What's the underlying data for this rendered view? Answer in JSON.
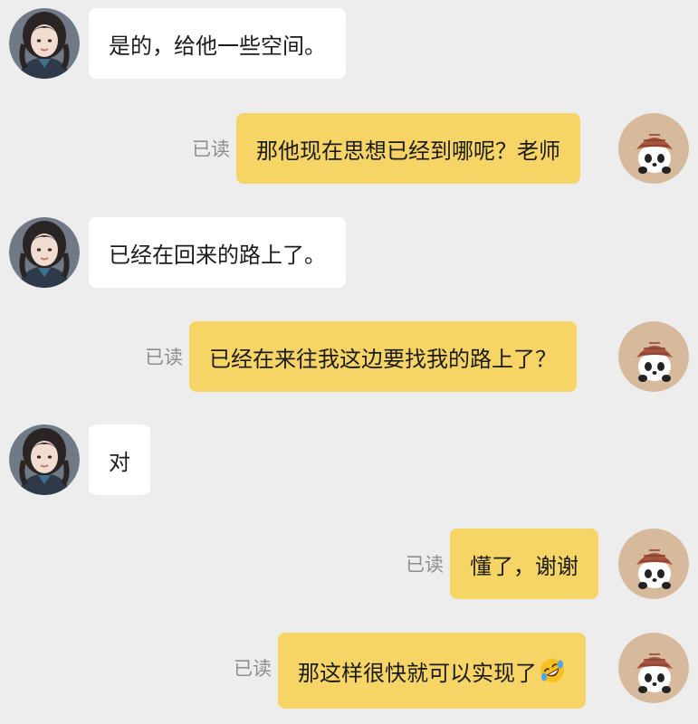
{
  "messages": [
    {
      "side": "in",
      "text": "是的，给他一些空间。"
    },
    {
      "side": "out",
      "text": "那他现在思想已经到哪呢？老师",
      "status": "已读"
    },
    {
      "side": "in",
      "text": "已经在回来的路上了。"
    },
    {
      "side": "out",
      "text": "已经在来往我这边要找我的路上了？",
      "status": "已读"
    },
    {
      "side": "in",
      "text": "对"
    },
    {
      "side": "out",
      "text": "懂了，谢谢",
      "status": "已读"
    },
    {
      "side": "out",
      "text": "那这样很快就可以实现了",
      "status": "已读",
      "emoji": "rolling-on-floor-laughing-emoji"
    }
  ],
  "colors": {
    "background": "#ededed",
    "incoming_bubble": "#ffffff",
    "outgoing_bubble": "#f6d465",
    "read_status": "#8e8e8e"
  },
  "icons": {
    "incoming_avatar": "girl-avatar",
    "outgoing_avatar": "panda-hat-avatar"
  }
}
